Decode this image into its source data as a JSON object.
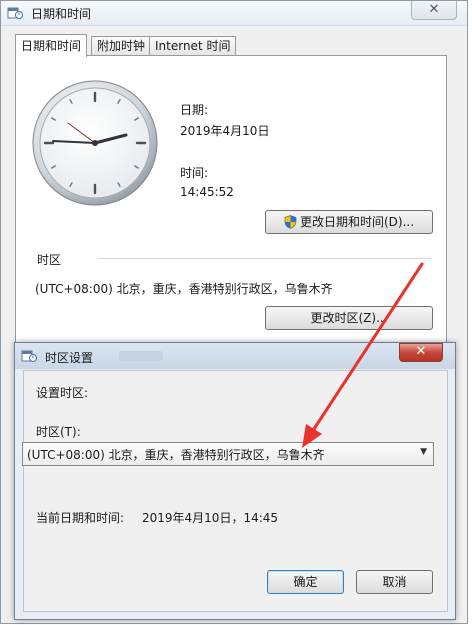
{
  "main_window": {
    "title": "日期和时间",
    "close_glyph": "✕",
    "tabs": [
      {
        "label": "日期和时间",
        "active": true
      },
      {
        "label": "附加时钟",
        "active": false
      },
      {
        "label": "Internet 时间",
        "active": false
      }
    ],
    "date_label": "日期:",
    "date_value": "2019年4月10日",
    "time_label": "时间:",
    "time_value": "14:45:52",
    "change_datetime_button": "更改日期和时间(D)...",
    "timezone_section_label": "时区",
    "timezone_value": "(UTC+08:00) 北京，重庆，香港特别行政区，乌鲁木齐",
    "change_timezone_button": "更改时区(Z)..."
  },
  "dialog": {
    "title": "时区设置",
    "close_glyph": "✕",
    "heading": "设置时区:",
    "timezone_label": "时区(T):",
    "timezone_selected": "(UTC+08:00) 北京，重庆，香港特别行政区，乌鲁木齐",
    "current_datetime_label": "当前日期和时间:",
    "current_datetime_value": "2019年4月10日，14:45",
    "ok_button": "确定",
    "cancel_button": "取消"
  },
  "colors": {
    "annotation_arrow": "#e8322a",
    "dialog_close": "#c6463a"
  },
  "icons": {
    "window": "datetime-window-icon",
    "clock": "analog-clock-icon",
    "shield": "uac-shield-icon",
    "dropdown": "chevron-down-icon"
  }
}
